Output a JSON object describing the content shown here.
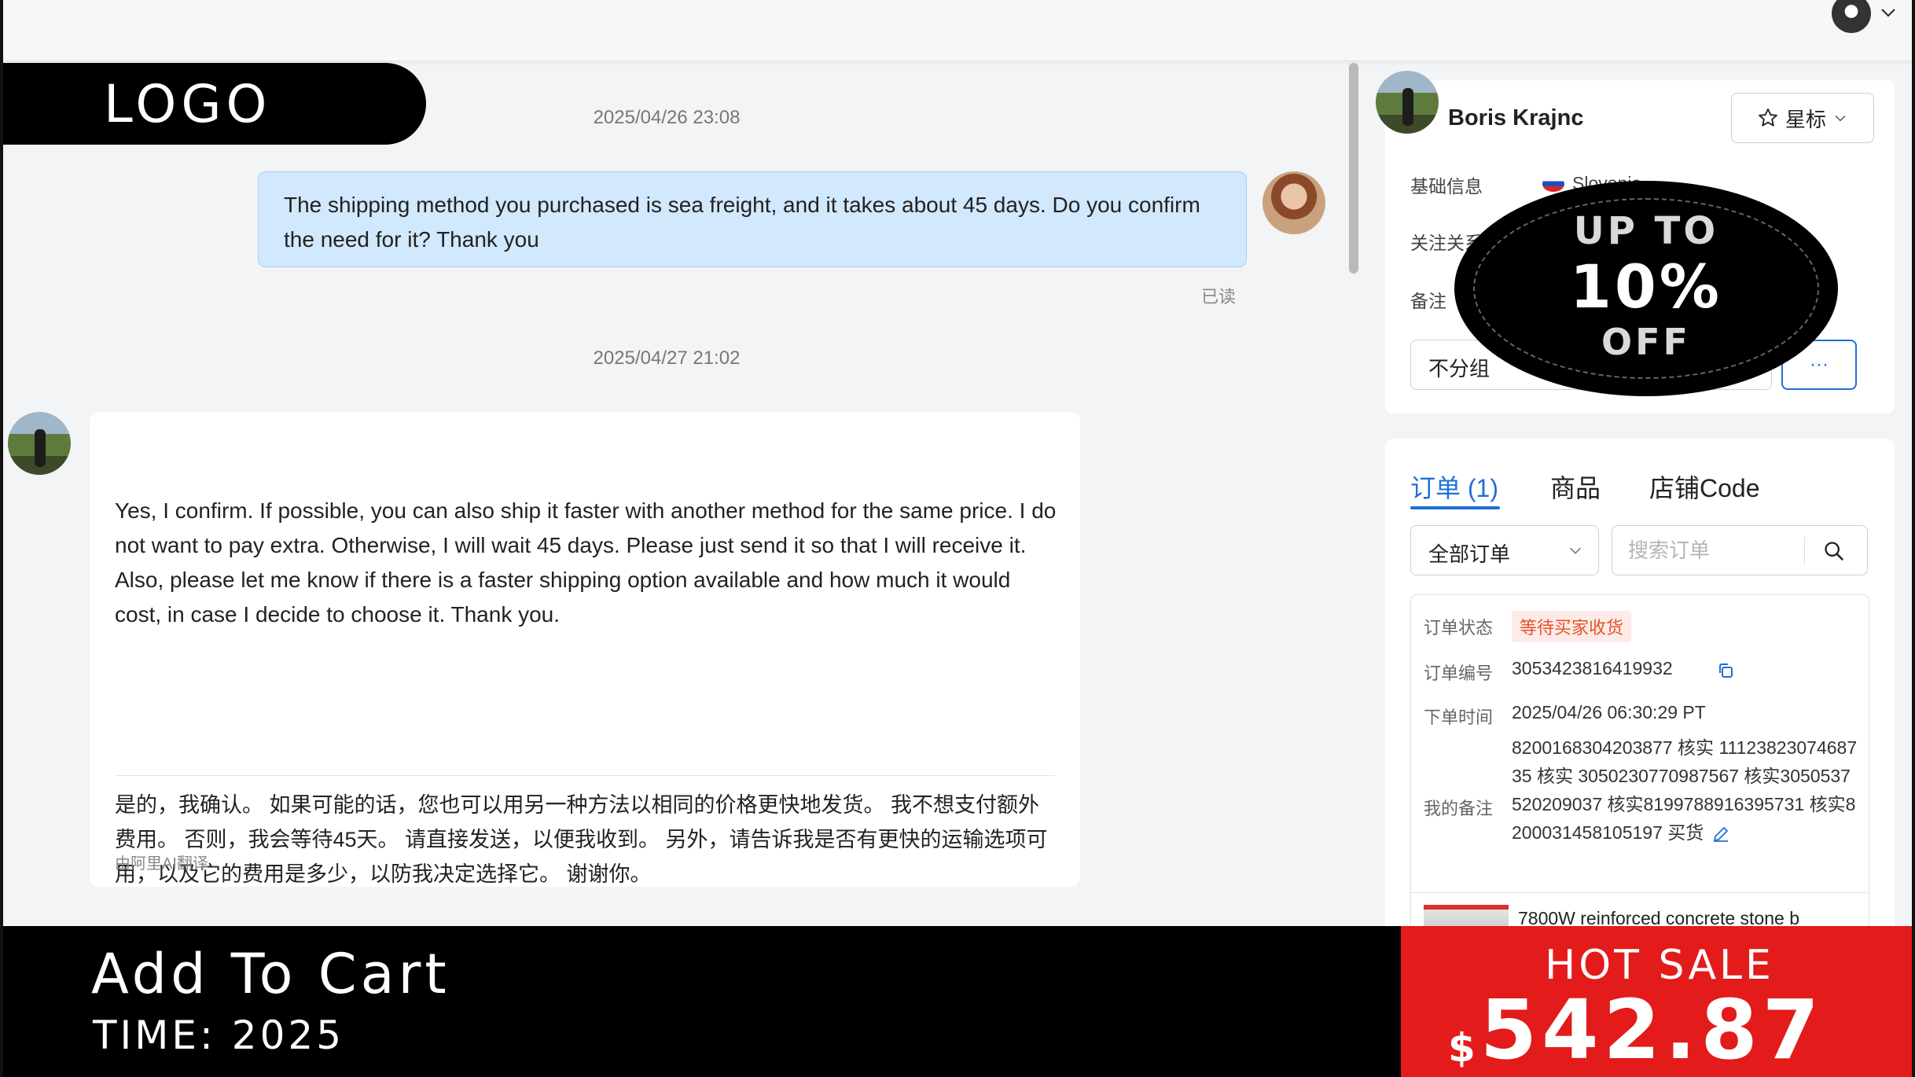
{
  "logo": {
    "text": "LOGO"
  },
  "chat": {
    "messages": [
      {
        "timestamp": "2025/04/26 23:08",
        "text": "The shipping method you purchased is sea freight, and it takes about 45 days. Do you confirm the need for it? Thank you",
        "status": "已读"
      },
      {
        "timestamp": "2025/04/27 21:02",
        "text": "Yes, I confirm. If possible, you can also ship it faster with another method for the same price. I do not want to pay extra. Otherwise, I will wait 45 days. Please just send it so that I will receive it. Also, please let me know if there is a faster shipping option available and how much it would cost, in case I decide to choose it. Thank you.",
        "translation": "是的，我确认。 如果可能的话，您也可以用另一种方法以相同的价格更快地发货。 我不想支付额外费用。 否则，我会等待45天。 请直接发送，以便我收到。 另外，请告诉我是否有更快的运输选项可用，以及它的费用是多少，以防我决定选择它。 谢谢你。",
        "translated_by": "由阿里AI翻译"
      }
    ]
  },
  "profile": {
    "name": "Boris Krajnc",
    "star_label": "星标",
    "basic_info_label": "基础信息",
    "country": "Slovenia",
    "relation_label": "关注关系",
    "note_label": "备注",
    "group_value": "不分组",
    "more_label": "···"
  },
  "promo": {
    "line1": "UP TO",
    "line2": "10%",
    "line3": "OFF"
  },
  "orders": {
    "tabs": [
      {
        "label": "订单 (1)"
      },
      {
        "label": "商品"
      },
      {
        "label": "店铺Code"
      }
    ],
    "filter_value": "全部订单",
    "search_placeholder": "搜索订单",
    "item": {
      "status_label": "订单状态",
      "status_value": "等待买家收货",
      "number_label": "订单编号",
      "number_value": "3053423816419932",
      "time_label": "下单时间",
      "time_value": "2025/04/26 06:30:29 PT",
      "note_label": "我的备注",
      "note_value": "8200168304203877 核实 1112382307468735 核实 3050230770987567 核实3050537520209037 核实8199788916395731 核实8200031458105197 买货",
      "product_title": "7800W reinforced concrete stone b"
    }
  },
  "banner": {
    "title": "Add To Cart",
    "time": "TIME: 2025",
    "hot_sale": "HOT SALE",
    "currency": "$",
    "price": "542.87"
  },
  "colors": {
    "accent": "#1f6fd8",
    "outgoing_bubble": "#d2e8fd",
    "status_badge": "#e6532d",
    "hot_sale_bg": "#e31b1b"
  }
}
